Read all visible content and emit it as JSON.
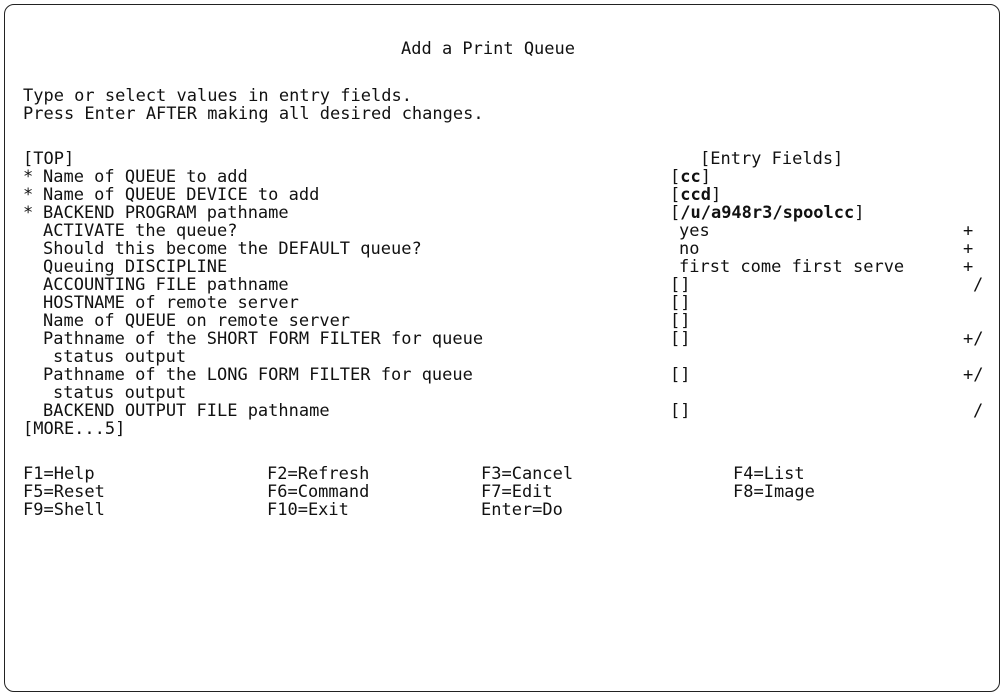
{
  "title": "Add a Print Queue",
  "instructions": [
    "Type or select values in entry fields.",
    "Press Enter AFTER making all desired changes."
  ],
  "top_marker": "[TOP]",
  "entry_fields_header": "[Entry Fields]",
  "more_marker": "[MORE...5]",
  "fields": [
    {
      "required": "*",
      "label": "Name of QUEUE to add",
      "value": "cc",
      "indicator": ""
    },
    {
      "required": "*",
      "label": "Name of QUEUE DEVICE to add",
      "value": "ccd",
      "indicator": ""
    },
    {
      "required": "*",
      "label": "BACKEND PROGRAM pathname",
      "value": "/u/a948r3/spoolcc",
      "indicator": ""
    },
    {
      "required": "",
      "label": "ACTIVATE the queue?",
      "value": "yes",
      "indicator": "+"
    },
    {
      "required": "",
      "label": "Should this become the DEFAULT queue?",
      "value": "no",
      "indicator": "+"
    },
    {
      "required": "",
      "label": "Queuing DISCIPLINE",
      "value": "first come first serve",
      "indicator": "+"
    },
    {
      "required": "",
      "label": "ACCOUNTING FILE pathname",
      "value": "[]",
      "indicator": "/"
    },
    {
      "required": "",
      "label": "HOSTNAME of remote server",
      "value": "[]",
      "indicator": ""
    },
    {
      "required": "",
      "label": "Name of QUEUE on remote server",
      "value": "[]",
      "indicator": ""
    },
    {
      "required": "",
      "label": "Pathname of the SHORT FORM FILTER for queue",
      "label2": "status output",
      "value": "[]",
      "indicator": "+/"
    },
    {
      "required": "",
      "label": "Pathname of the LONG FORM FILTER for queue",
      "label2": "status output",
      "value": "[]",
      "indicator": "+/"
    },
    {
      "required": "",
      "label": "BACKEND OUTPUT FILE pathname",
      "value": "[]",
      "indicator": "/"
    }
  ],
  "function_keys": [
    [
      "F1=Help",
      "F2=Refresh",
      "F3=Cancel",
      "F4=List"
    ],
    [
      "F5=Reset",
      "F6=Command",
      "F7=Edit",
      "F8=Image"
    ],
    [
      "F9=Shell",
      "F10=Exit",
      "Enter=Do"
    ]
  ]
}
